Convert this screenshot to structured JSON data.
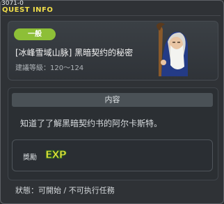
{
  "window": {
    "code": "3071-0",
    "title": "QUEST INFO"
  },
  "quest": {
    "category": "一般",
    "name": "[冰峰雪域山脉] 黑暗契约的秘密",
    "level_range": "建議等級：120～124",
    "content_header": "内容",
    "description": "知道了了解黑暗契约书的阿尔卡斯特。",
    "reward_label": "獎勵",
    "reward_exp": "EXP",
    "status": "狀態：可開始 / 不可执行任務"
  },
  "colors": {
    "title": "#f2df4a",
    "badge": "#8dbf37",
    "exp": "#f5e33d"
  },
  "icons": {
    "npc": "old-wizard-portrait-icon"
  }
}
